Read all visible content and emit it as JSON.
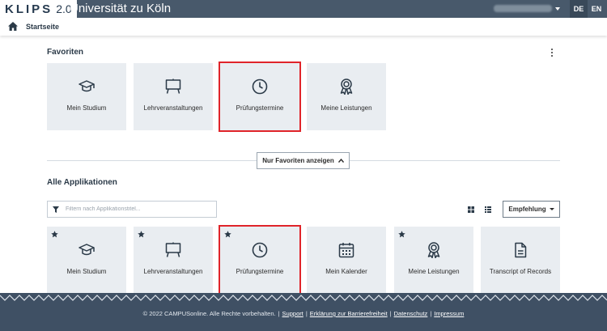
{
  "header": {
    "logo_text": "KLIPS",
    "logo_version": "2.0",
    "university": "Universität zu Köln",
    "languages": [
      "DE",
      "EN"
    ]
  },
  "breadcrumb": {
    "home_icon": "home-icon",
    "current": "Startseite"
  },
  "favorites": {
    "title": "Favoriten",
    "tiles": [
      {
        "label": "Mein Studium",
        "icon": "graduation-cap-icon"
      },
      {
        "label": "Lehrveranstaltungen",
        "icon": "presentation-board-icon"
      },
      {
        "label": "Prüfungstermine",
        "icon": "clock-icon"
      },
      {
        "label": "Meine Leistungen",
        "icon": "award-ribbon-icon"
      }
    ]
  },
  "toggle_favorites_label": "Nur Favoriten anzeigen",
  "all_apps": {
    "title": "Alle Applikationen",
    "filter_placeholder": "Filtern nach Applikationstitel...",
    "sort_label": "Empfehlung",
    "tiles": [
      {
        "label": "Mein Studium",
        "icon": "graduation-cap-icon",
        "favorite": true
      },
      {
        "label": "Lehrveranstaltungen",
        "icon": "presentation-board-icon",
        "favorite": true
      },
      {
        "label": "Prüfungstermine",
        "icon": "clock-icon",
        "favorite": true
      },
      {
        "label": "Mein Kalender",
        "icon": "calendar-icon",
        "favorite": false
      },
      {
        "label": "Meine Leistungen",
        "icon": "award-ribbon-icon",
        "favorite": true
      },
      {
        "label": "Transcript of Records",
        "icon": "document-icon",
        "favorite": false
      }
    ]
  },
  "footer": {
    "copyright": "© 2022 CAMPUSonline. Alle Rechte vorbehalten.",
    "links": [
      "Support",
      "Erklärung zur Barrierefreiheit",
      "Datenschutz",
      "Impressum"
    ]
  },
  "colors": {
    "header_bg": "#48596b",
    "tile_bg": "#e9edf1",
    "highlight": "#e0242a",
    "footer_bg": "#3f5064"
  }
}
